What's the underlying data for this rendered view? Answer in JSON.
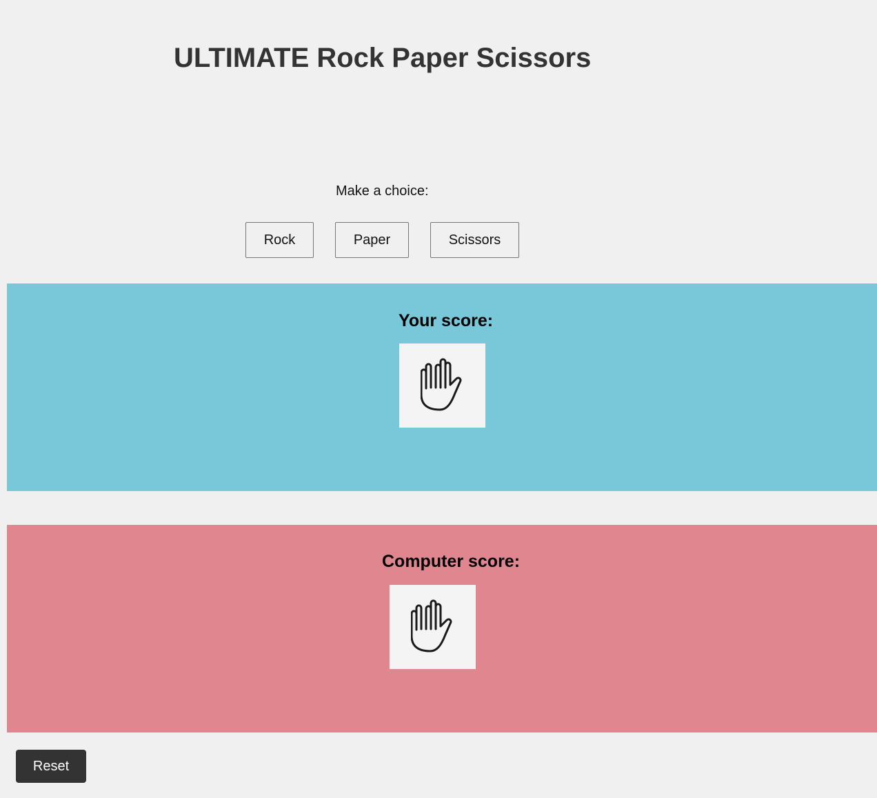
{
  "page": {
    "title": "ULTIMATE Rock Paper Scissors"
  },
  "choices": {
    "prompt": "Make a choice:",
    "rock_label": "Rock",
    "paper_label": "Paper",
    "scissors_label": "Scissors"
  },
  "player": {
    "heading": "Your score:",
    "hand_icon": "hand-paper-icon",
    "panel_color": "#78c8da"
  },
  "computer": {
    "heading": "Computer score:",
    "hand_icon": "hand-paper-icon",
    "panel_color": "#e0868f"
  },
  "controls": {
    "reset_label": "Reset"
  },
  "colors": {
    "background": "#f0f0f0",
    "reset_button": "#333333"
  }
}
